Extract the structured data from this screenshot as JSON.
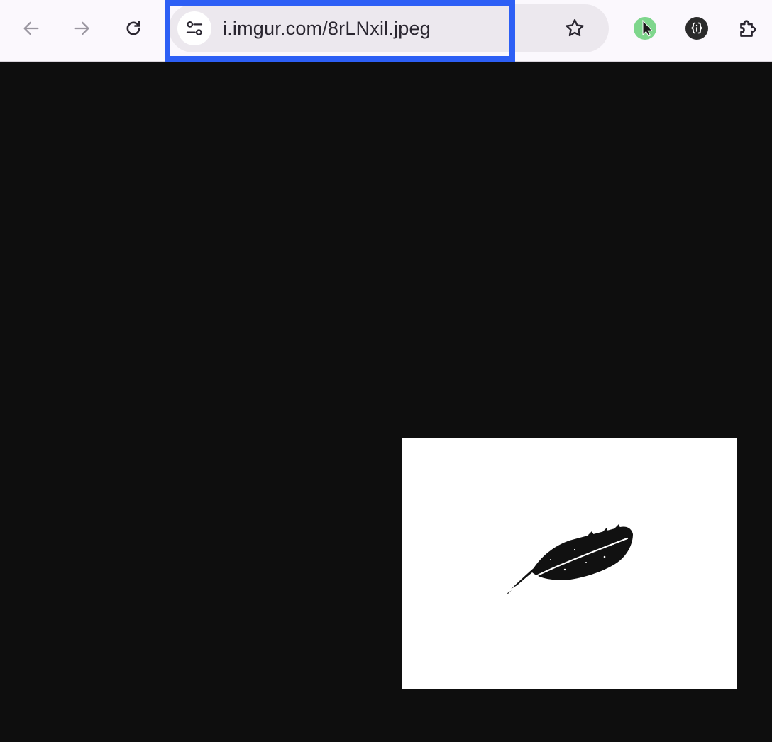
{
  "browser": {
    "nav": {
      "back_icon": "arrow-left-icon",
      "forward_icon": "arrow-right-icon",
      "reload_icon": "reload-icon"
    },
    "omnibox": {
      "site_info_icon": "tune-icon",
      "url": "i.imgur.com/8rLNxil.jpeg",
      "bookmark_icon": "star-icon"
    },
    "extensions": [
      {
        "icon": "cursor-extension-icon",
        "color": "#7ed68c"
      },
      {
        "icon": "json-extension-icon",
        "color": "#2b2b2b"
      },
      {
        "icon": "puzzle-icon",
        "color": "#2a2630"
      }
    ],
    "highlight_color": "#2d5ff5"
  },
  "page": {
    "background": "#0e0e0e",
    "image": {
      "subject": "feather-icon",
      "background": "#ffffff"
    }
  }
}
